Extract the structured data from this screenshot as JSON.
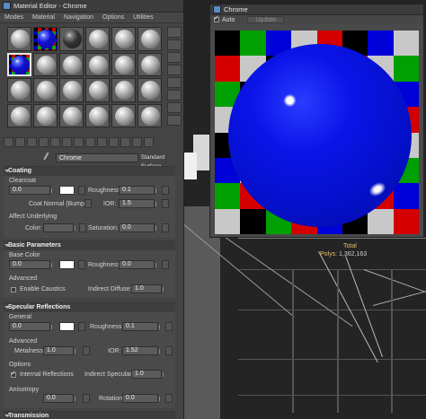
{
  "material_editor": {
    "title": "Material Editor - Chrome",
    "menu": [
      "Modes",
      "Material",
      "Navigation",
      "Options",
      "Utilities"
    ],
    "material_name": "Chrome",
    "material_type": "Standard Surface",
    "coating": {
      "header": "Coating",
      "clearcoat_label": "Clearcoat",
      "clearcoat_value": "0.0",
      "roughness_label": "Roughness:",
      "roughness_value": "0.1",
      "coat_normal_label": "Coat Normal (Bump):",
      "ior_label": "IOR:",
      "ior_value": "1.5",
      "affect_underlying_label": "Affect Underlying",
      "color_label": "Color:",
      "saturation_label": "Saturation:",
      "saturation_value": "0.0"
    },
    "basic": {
      "header": "Basic Parameters",
      "base_color_label": "Base Color",
      "base_value": "0.0",
      "roughness_label": "Roughness:",
      "roughness_value": "0.0",
      "advanced_label": "Advanced",
      "enable_caustics_label": "Enable Caustics",
      "indirect_diffuse_label": "Indirect Diffuse:",
      "indirect_diffuse_value": "1.0"
    },
    "specular": {
      "header": "Specular Reflections",
      "general_label": "General",
      "general_value": "0.0",
      "roughness_label": "Roughness:",
      "roughness_value": "0.1",
      "advanced_label": "Advanced",
      "metalness_label": "Metalness:",
      "metalness_value": "1.0",
      "ior_label": "IOR:",
      "ior_value": "1.52",
      "options_label": "Options",
      "internal_reflections_label": "Internal Reflections",
      "indirect_specular_label": "Indirect Specular:",
      "indirect_specular_value": "1.0",
      "anisotropy_label": "Anisotropy",
      "aniso_value": "0.0",
      "rotation_label": "Rotation:",
      "rotation_value": "0.0"
    },
    "transmission": {
      "header": "Transmission"
    }
  },
  "render_window": {
    "title": "Chrome",
    "auto_label": "Auto",
    "update_label": "Update"
  },
  "viewport": {
    "total_label": "Total",
    "polys_label": "Polys:",
    "polys_value": "1,362,163"
  }
}
